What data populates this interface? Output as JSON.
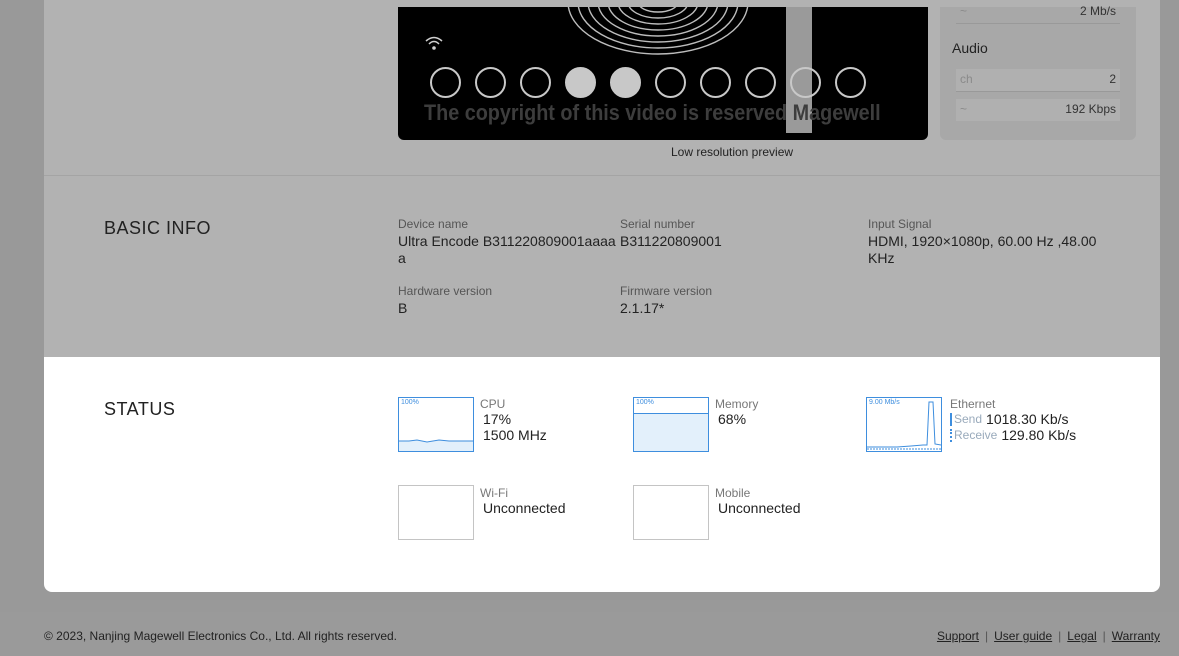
{
  "video": {
    "watermark": "The copyright of this video is reserved    Magewell",
    "preview_label": "Low resolution preview"
  },
  "side_panel": {
    "video_bitrate": "2 Mb/s",
    "audio_title": "Audio",
    "audio_channels_key": "ch",
    "audio_channels": "2",
    "audio_bitrate": "192 Kbps"
  },
  "basic_info": {
    "title": "BASIC INFO",
    "device_name_label": "Device name",
    "device_name": "Ultra Encode B311220809001aaaaa",
    "serial_label": "Serial number",
    "serial": "B311220809001",
    "input_label": "Input Signal",
    "input": "HDMI, 1920×1080p, 60.00 Hz ,48.00 KHz",
    "hw_label": "Hardware version",
    "hw": "B",
    "fw_label": "Firmware version",
    "fw": "2.1.17*"
  },
  "status": {
    "title": "STATUS",
    "cpu": {
      "tag": "100%",
      "name": "CPU",
      "usage": "17%",
      "freq": "1500 MHz",
      "level": 0.17
    },
    "memory": {
      "tag": "100%",
      "name": "Memory",
      "usage": "68%",
      "level": 0.68
    },
    "ethernet": {
      "tag": "9.00 Mb/s",
      "name": "Ethernet",
      "send_label": "Send",
      "send": "1018.30 Kb/s",
      "receive_label": "Receive",
      "receive": "129.80 Kb/s"
    },
    "wifi": {
      "name": "Wi-Fi",
      "state": "Unconnected"
    },
    "mobile": {
      "name": "Mobile",
      "state": "Unconnected"
    }
  },
  "footer": {
    "copyright": "© 2023, Nanjing Magewell Electronics Co., Ltd. All rights reserved.",
    "links": [
      "Support",
      "User guide",
      "Legal",
      "Warranty"
    ]
  },
  "colors": {
    "accent": "#3e8ede",
    "overlay": "#999999",
    "active_panel": "#ffffff"
  }
}
